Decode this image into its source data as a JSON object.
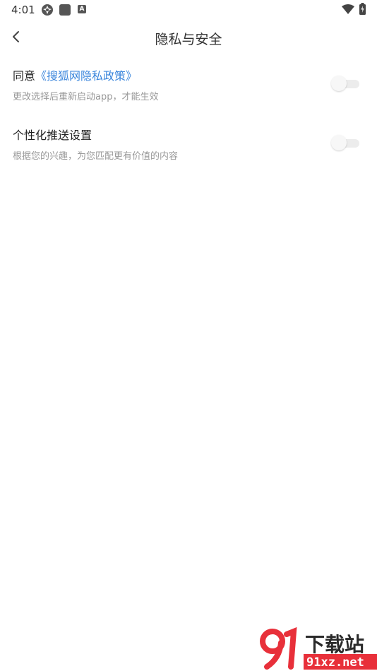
{
  "status_bar": {
    "time": "4:01",
    "icons": [
      "settings-icon",
      "square-notification-icon",
      "a-notification-icon",
      "wifi-icon",
      "battery-charging-icon"
    ],
    "a_icon_letter": "A"
  },
  "header": {
    "back_icon": "chevron-left-icon",
    "title": "隐私与安全"
  },
  "settings": [
    {
      "title_prefix": "同意",
      "title_link": "《搜狐网隐私政策》",
      "description": "更改选择后重新启动app，才能生效",
      "enabled": false
    },
    {
      "title": "个性化推送设置",
      "description": "根据您的兴趣，为您匹配更有价值的内容",
      "enabled": false
    }
  ],
  "watermark": {
    "logo_text": "下载站",
    "domain": "91xz.net"
  },
  "colors": {
    "link": "#3b86dc",
    "description": "#999999",
    "title": "#222222",
    "toggle_track_off": "#ececec",
    "watermark_red": "#e8303a"
  }
}
